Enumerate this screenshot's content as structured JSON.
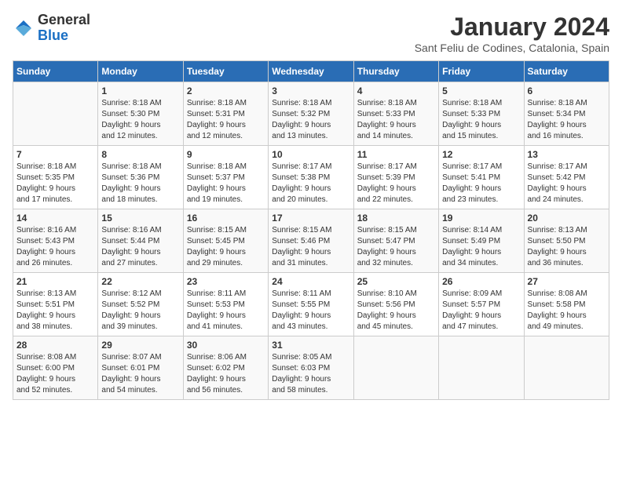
{
  "logo": {
    "text_general": "General",
    "text_blue": "Blue"
  },
  "header": {
    "month": "January 2024",
    "location": "Sant Feliu de Codines, Catalonia, Spain"
  },
  "weekdays": [
    "Sunday",
    "Monday",
    "Tuesday",
    "Wednesday",
    "Thursday",
    "Friday",
    "Saturday"
  ],
  "weeks": [
    [
      {
        "day": "",
        "info": ""
      },
      {
        "day": "1",
        "info": "Sunrise: 8:18 AM\nSunset: 5:30 PM\nDaylight: 9 hours\nand 12 minutes."
      },
      {
        "day": "2",
        "info": "Sunrise: 8:18 AM\nSunset: 5:31 PM\nDaylight: 9 hours\nand 12 minutes."
      },
      {
        "day": "3",
        "info": "Sunrise: 8:18 AM\nSunset: 5:32 PM\nDaylight: 9 hours\nand 13 minutes."
      },
      {
        "day": "4",
        "info": "Sunrise: 8:18 AM\nSunset: 5:33 PM\nDaylight: 9 hours\nand 14 minutes."
      },
      {
        "day": "5",
        "info": "Sunrise: 8:18 AM\nSunset: 5:33 PM\nDaylight: 9 hours\nand 15 minutes."
      },
      {
        "day": "6",
        "info": "Sunrise: 8:18 AM\nSunset: 5:34 PM\nDaylight: 9 hours\nand 16 minutes."
      }
    ],
    [
      {
        "day": "7",
        "info": "Sunrise: 8:18 AM\nSunset: 5:35 PM\nDaylight: 9 hours\nand 17 minutes."
      },
      {
        "day": "8",
        "info": "Sunrise: 8:18 AM\nSunset: 5:36 PM\nDaylight: 9 hours\nand 18 minutes."
      },
      {
        "day": "9",
        "info": "Sunrise: 8:18 AM\nSunset: 5:37 PM\nDaylight: 9 hours\nand 19 minutes."
      },
      {
        "day": "10",
        "info": "Sunrise: 8:17 AM\nSunset: 5:38 PM\nDaylight: 9 hours\nand 20 minutes."
      },
      {
        "day": "11",
        "info": "Sunrise: 8:17 AM\nSunset: 5:39 PM\nDaylight: 9 hours\nand 22 minutes."
      },
      {
        "day": "12",
        "info": "Sunrise: 8:17 AM\nSunset: 5:41 PM\nDaylight: 9 hours\nand 23 minutes."
      },
      {
        "day": "13",
        "info": "Sunrise: 8:17 AM\nSunset: 5:42 PM\nDaylight: 9 hours\nand 24 minutes."
      }
    ],
    [
      {
        "day": "14",
        "info": "Sunrise: 8:16 AM\nSunset: 5:43 PM\nDaylight: 9 hours\nand 26 minutes."
      },
      {
        "day": "15",
        "info": "Sunrise: 8:16 AM\nSunset: 5:44 PM\nDaylight: 9 hours\nand 27 minutes."
      },
      {
        "day": "16",
        "info": "Sunrise: 8:15 AM\nSunset: 5:45 PM\nDaylight: 9 hours\nand 29 minutes."
      },
      {
        "day": "17",
        "info": "Sunrise: 8:15 AM\nSunset: 5:46 PM\nDaylight: 9 hours\nand 31 minutes."
      },
      {
        "day": "18",
        "info": "Sunrise: 8:15 AM\nSunset: 5:47 PM\nDaylight: 9 hours\nand 32 minutes."
      },
      {
        "day": "19",
        "info": "Sunrise: 8:14 AM\nSunset: 5:49 PM\nDaylight: 9 hours\nand 34 minutes."
      },
      {
        "day": "20",
        "info": "Sunrise: 8:13 AM\nSunset: 5:50 PM\nDaylight: 9 hours\nand 36 minutes."
      }
    ],
    [
      {
        "day": "21",
        "info": "Sunrise: 8:13 AM\nSunset: 5:51 PM\nDaylight: 9 hours\nand 38 minutes."
      },
      {
        "day": "22",
        "info": "Sunrise: 8:12 AM\nSunset: 5:52 PM\nDaylight: 9 hours\nand 39 minutes."
      },
      {
        "day": "23",
        "info": "Sunrise: 8:11 AM\nSunset: 5:53 PM\nDaylight: 9 hours\nand 41 minutes."
      },
      {
        "day": "24",
        "info": "Sunrise: 8:11 AM\nSunset: 5:55 PM\nDaylight: 9 hours\nand 43 minutes."
      },
      {
        "day": "25",
        "info": "Sunrise: 8:10 AM\nSunset: 5:56 PM\nDaylight: 9 hours\nand 45 minutes."
      },
      {
        "day": "26",
        "info": "Sunrise: 8:09 AM\nSunset: 5:57 PM\nDaylight: 9 hours\nand 47 minutes."
      },
      {
        "day": "27",
        "info": "Sunrise: 8:08 AM\nSunset: 5:58 PM\nDaylight: 9 hours\nand 49 minutes."
      }
    ],
    [
      {
        "day": "28",
        "info": "Sunrise: 8:08 AM\nSunset: 6:00 PM\nDaylight: 9 hours\nand 52 minutes."
      },
      {
        "day": "29",
        "info": "Sunrise: 8:07 AM\nSunset: 6:01 PM\nDaylight: 9 hours\nand 54 minutes."
      },
      {
        "day": "30",
        "info": "Sunrise: 8:06 AM\nSunset: 6:02 PM\nDaylight: 9 hours\nand 56 minutes."
      },
      {
        "day": "31",
        "info": "Sunrise: 8:05 AM\nSunset: 6:03 PM\nDaylight: 9 hours\nand 58 minutes."
      },
      {
        "day": "",
        "info": ""
      },
      {
        "day": "",
        "info": ""
      },
      {
        "day": "",
        "info": ""
      }
    ]
  ]
}
